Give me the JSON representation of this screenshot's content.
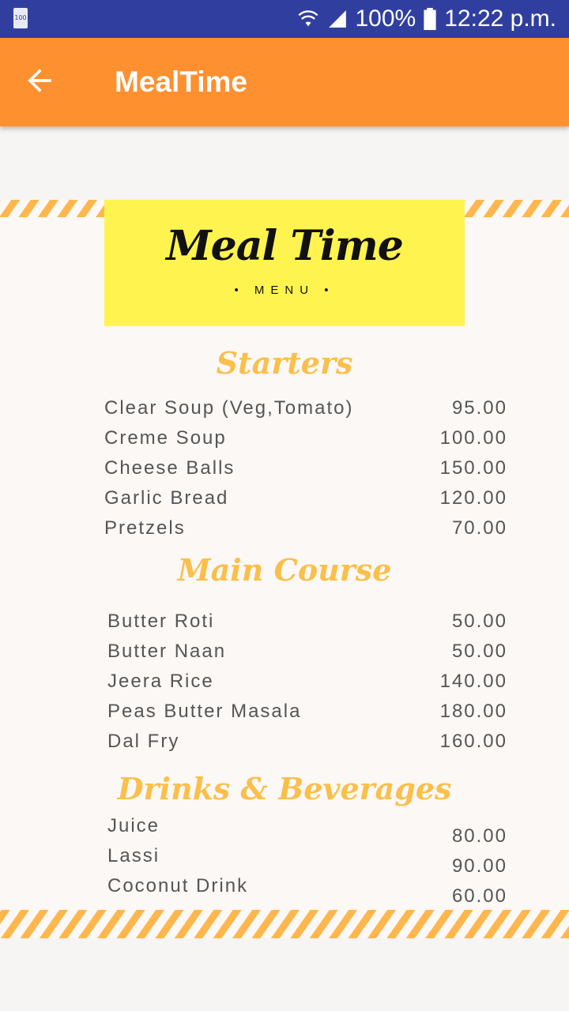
{
  "status_bar": {
    "battery_small_label": "100",
    "battery_percent": "100%",
    "time": "12:22 p.m.",
    "icons": [
      "battery-icon",
      "wifi-icon",
      "signal-icon",
      "battery-full-icon"
    ]
  },
  "app_bar": {
    "title": "MealTime",
    "back_icon": "arrow-left-icon",
    "color": "#ff9030"
  },
  "logo": {
    "title": "Meal Time",
    "subtitle": "• MENU •",
    "background": "#fff44f"
  },
  "sections": [
    {
      "title": "Starters",
      "items": [
        {
          "name": "Clear Soup (Veg,Tomato)",
          "price": "95.00"
        },
        {
          "name": "Creme Soup",
          "price": "100.00"
        },
        {
          "name": "Cheese Balls",
          "price": "150.00"
        },
        {
          "name": "Garlic Bread",
          "price": "120.00"
        },
        {
          "name": "Pretzels",
          "price": "70.00"
        }
      ]
    },
    {
      "title": "Main Course",
      "items": [
        {
          "name": "Butter Roti",
          "price": "50.00"
        },
        {
          "name": "Butter Naan",
          "price": "50.00"
        },
        {
          "name": "Jeera Rice",
          "price": "140.00"
        },
        {
          "name": "Peas Butter Masala",
          "price": "180.00"
        },
        {
          "name": "Dal Fry",
          "price": "160.00"
        }
      ]
    },
    {
      "title": "Drinks & Beverages",
      "items": [
        {
          "name": "Juice",
          "price": "80.00"
        },
        {
          "name": "Lassi",
          "price": "90.00"
        },
        {
          "name": "Coconut Drink",
          "price": "60.00"
        }
      ]
    }
  ],
  "colors": {
    "status_bar": "#303f9f",
    "accent": "#fbbf4a",
    "stripe": "#ffb74d"
  }
}
